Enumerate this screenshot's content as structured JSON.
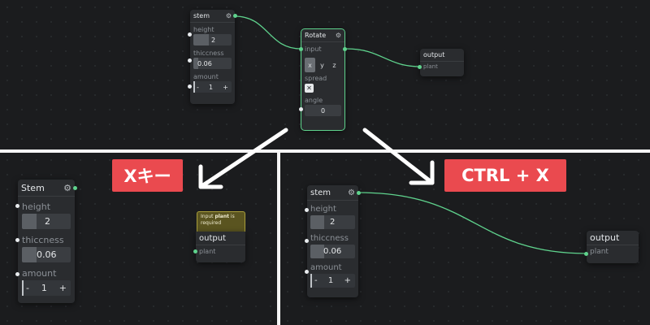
{
  "top": {
    "stem": {
      "title": "stem",
      "height_label": "height",
      "height_value": "2",
      "height_fill": 0.4,
      "thickness_label": "thiccness",
      "thickness_value": "0.06",
      "thickness_fill": 0.12,
      "amount_label": "amount",
      "amount_value": "1",
      "minus": "-",
      "plus": "+"
    },
    "rotate": {
      "title": "Rotate",
      "input_label": "input",
      "axis_x": "x",
      "axis_y": "y",
      "axis_z": "z",
      "spread_label": "spread",
      "spread_checked": "✕",
      "angle_label": "angle",
      "angle_value": "0"
    },
    "output": {
      "title": "output",
      "port_label": "plant"
    }
  },
  "annotations": {
    "x_key": "Xキー",
    "ctrl_x": "CTRL + X",
    "badge_color": "#ea4a4f",
    "wire_color": "#5fd38d"
  },
  "bottom_left": {
    "stem": {
      "title": "Stem",
      "height_label": "height",
      "height_value": "2",
      "height_fill": 0.3,
      "thickness_label": "thiccness",
      "thickness_value": "0.06",
      "thickness_fill": 0.3,
      "amount_label": "amount",
      "amount_value": "1",
      "minus": "-",
      "plus": "+"
    },
    "tooltip": {
      "prefix": "Input ",
      "emph": "plant",
      "suffix": " is required"
    },
    "output": {
      "title": "output",
      "port_label": "plant"
    }
  },
  "bottom_right": {
    "stem": {
      "title": "stem",
      "height_label": "height",
      "height_value": "2",
      "height_fill": 0.3,
      "thickness_label": "thiccness",
      "thickness_value": "0.06",
      "thickness_fill": 0.3,
      "amount_label": "amount",
      "amount_value": "1",
      "minus": "-",
      "plus": "+"
    },
    "output": {
      "title": "output",
      "port_label": "plant"
    }
  }
}
